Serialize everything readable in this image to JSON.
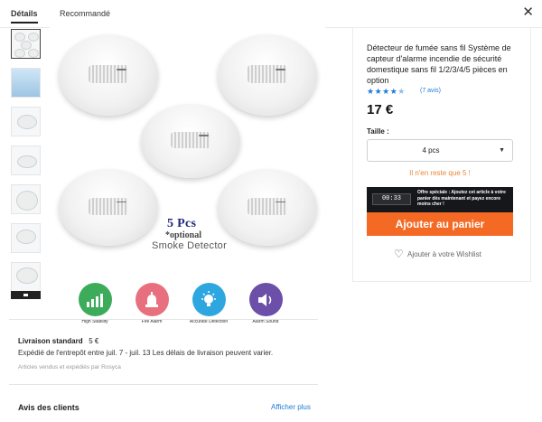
{
  "tabs": [
    {
      "label": "Détails",
      "active": true
    },
    {
      "label": "Recommandé",
      "active": false
    }
  ],
  "close_icon": "close-icon",
  "image": {
    "count_text": "5 Pcs",
    "optional_text": "*optional",
    "caption": "Smoke Detector",
    "features": [
      {
        "label": "High Stability",
        "color": "#3cab5a",
        "icon": "growth-chart-icon"
      },
      {
        "label": "Fire Alarm",
        "color": "#e8707e",
        "icon": "siren-icon"
      },
      {
        "label": "Accurate Detection",
        "color": "#2ea7e0",
        "icon": "bulb-icon"
      },
      {
        "label": "Alarm Sound",
        "color": "#6b4fa8",
        "icon": "speaker-icon"
      }
    ]
  },
  "product": {
    "title": "Détecteur de fumée sans fil Système de capteur d'alarme incendie de sécurité domestique sans fil 1/2/3/4/5 pièces en option",
    "rating": 4.5,
    "reviews": "(7 avis)",
    "price": "17 €",
    "size_label": "Taille :",
    "size_value": "4 pcs",
    "stock": "Il n'en reste que 5 !",
    "timer": "00:33",
    "offer": "Offre spéciale : Ajoutez cet article à votre panier dès maintenant et payez encore moins cher !",
    "add_to_cart": "Ajouter au panier",
    "wishlist": "Ajouter à votre Wishlist"
  },
  "shipping": {
    "title": "Livraison standard",
    "price": "5 €",
    "detail": "Expédié de l'entrepôt entre juil. 7 - juil. 13 Les délais de livraison peuvent varier.",
    "seller": "Articles vendus et expédiés par Rosyca"
  },
  "reviews_section": {
    "title": "Avis des clients",
    "show_more": "Afficher plus"
  },
  "colors": {
    "accent": "#f46a25",
    "link": "#1e7bd8",
    "stock": "#e8863a"
  }
}
